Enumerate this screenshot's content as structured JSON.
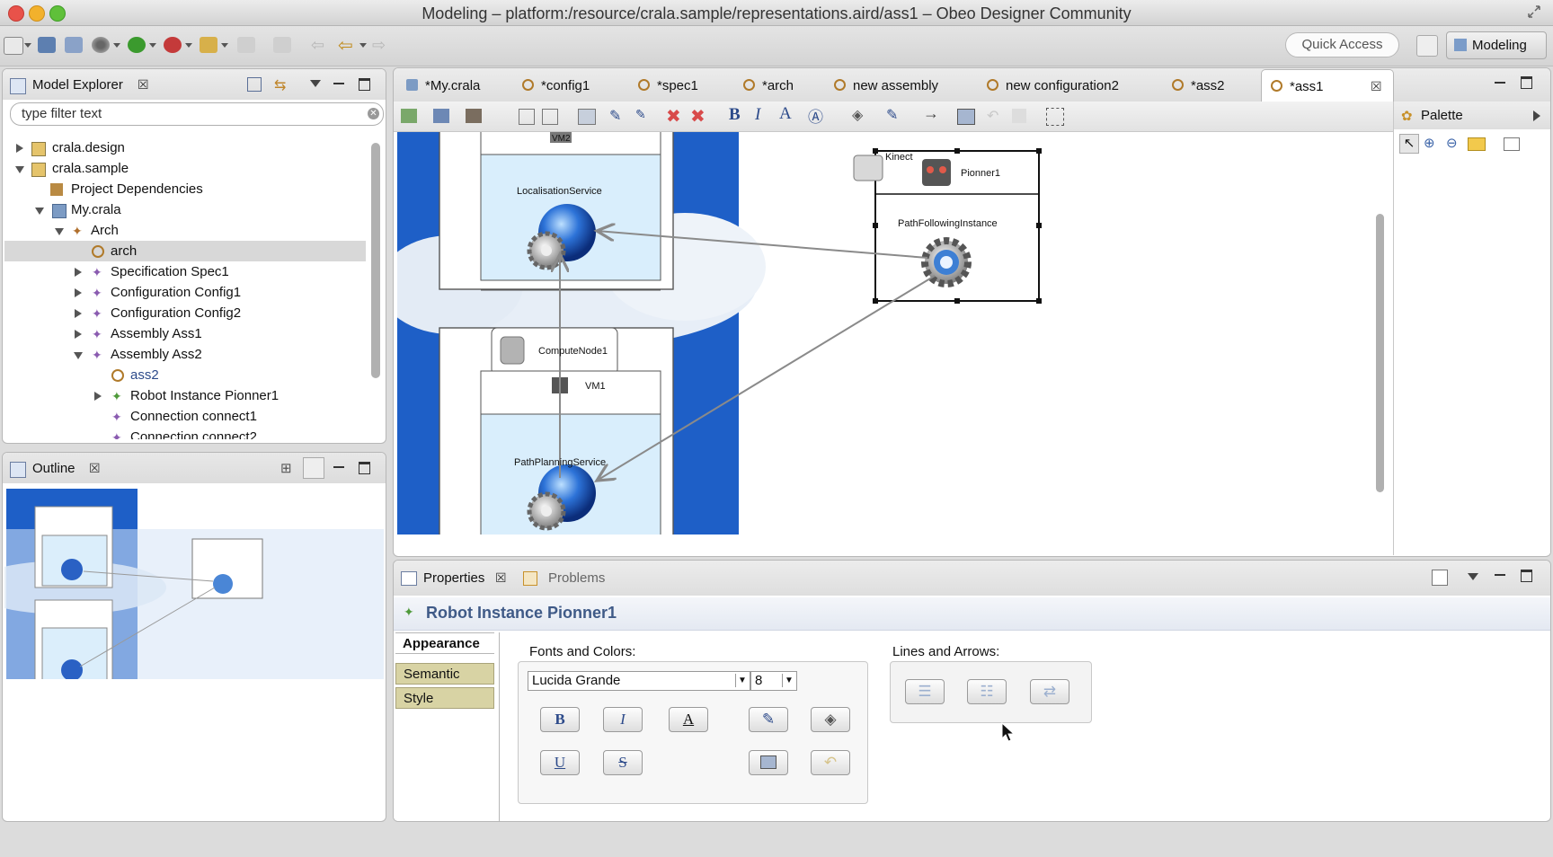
{
  "window": {
    "title": "Modeling – platform:/resource/crala.sample/representations.aird/ass1 – Obeo Designer Community"
  },
  "toolbar": {
    "quick_access": "Quick Access",
    "perspective": "Modeling"
  },
  "model_explorer": {
    "title": "Model Explorer",
    "filter_placeholder": "type filter text",
    "items": [
      {
        "label": "crala.design"
      },
      {
        "label": "crala.sample"
      },
      {
        "label": "Project Dependencies"
      },
      {
        "label": "My.crala"
      },
      {
        "label": "Arch"
      },
      {
        "label": "arch"
      },
      {
        "label": "Specification Spec1"
      },
      {
        "label": "Configuration Config1"
      },
      {
        "label": "Configuration Config2"
      },
      {
        "label": "Assembly Ass1"
      },
      {
        "label": "Assembly Ass2"
      },
      {
        "label": "ass2"
      },
      {
        "label": "Robot Instance Pionner1"
      },
      {
        "label": "Connection connect1"
      },
      {
        "label": "Connection connect2"
      }
    ]
  },
  "outline": {
    "title": "Outline"
  },
  "editor": {
    "tabs": [
      {
        "label": "*My.crala"
      },
      {
        "label": "*config1"
      },
      {
        "label": "*spec1"
      },
      {
        "label": "*arch"
      },
      {
        "label": "new assembly"
      },
      {
        "label": "new configuration2"
      },
      {
        "label": "*ass2"
      },
      {
        "label": "*ass1"
      }
    ],
    "active_tab": "*ass1"
  },
  "palette": {
    "title": "Palette"
  },
  "diagram": {
    "nodes": {
      "vm2": "VM2",
      "localisation_service": "LocalisationService",
      "compute_node": "ComputeNode1",
      "vm1": "VM1",
      "path_planning_service": "PathPlanningService",
      "kinect": "Kinect",
      "pionner": "Pionner1",
      "path_following": "PathFollowingInstance"
    }
  },
  "properties": {
    "tabs": [
      {
        "label": "Properties"
      },
      {
        "label": "Problems"
      }
    ],
    "selection_title": "Robot Instance Pionner1",
    "side_tabs": [
      {
        "label": "Appearance"
      },
      {
        "label": "Semantic"
      },
      {
        "label": "Style"
      }
    ],
    "fonts_section": "Fonts and Colors:",
    "font_family": "Lucida Grande",
    "font_size": "8",
    "lines_section": "Lines and Arrows:",
    "style_buttons": {
      "bold": "B",
      "italic": "I",
      "underline": "U",
      "strike": "S",
      "font_color": "A"
    }
  },
  "colors": {
    "cloud_blue": "#1e5fc7",
    "selection": "#d8d8d8",
    "section_tab_bg": "#d8d3a4"
  }
}
